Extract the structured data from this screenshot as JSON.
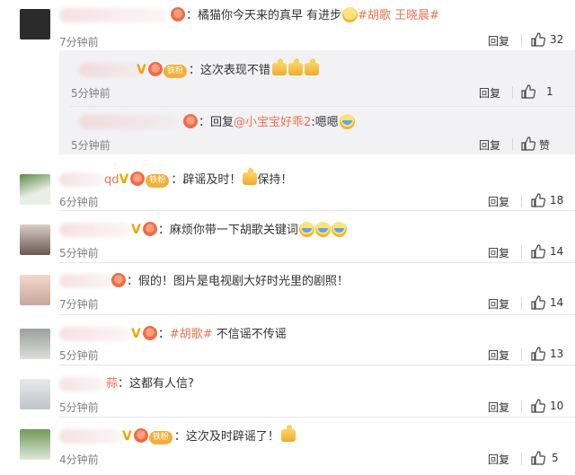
{
  "comments": [
    {
      "id": "c1",
      "time": "7分钟前",
      "reply": "回复",
      "likes": "32",
      "prefix": "：",
      "text": "橘猫你今天来的真早 有进步",
      "tag": "#胡歌 王晓晨#"
    },
    {
      "id": "c2",
      "time": "5分钟前",
      "reply": "回复",
      "likes": "1",
      "fan_badge": "铁粉",
      "prefix": "：",
      "text": "这次表现不错"
    },
    {
      "id": "c3",
      "time": "5分钟前",
      "reply": "回复",
      "likes": "赞",
      "prefix": "：",
      "reply_word": "回复",
      "mention": "@小宝宝好乖2",
      "colon": ":",
      "text": "嗯嗯"
    },
    {
      "id": "c4",
      "time": "6分钟前",
      "reply": "回复",
      "likes": "18",
      "fan_badge": "铁粉",
      "name_tail": "qd",
      "prefix": "：",
      "text": "辟谣及时！",
      "text2": "保持！"
    },
    {
      "id": "c5",
      "time": "5分钟前",
      "reply": "回复",
      "likes": "14",
      "prefix": "：",
      "text": "麻烦你带一下胡歌关键词"
    },
    {
      "id": "c6",
      "time": "7分钟前",
      "reply": "回复",
      "likes": "14",
      "prefix": "：",
      "text": "假的！图片是电视剧大好时光里的剧照！"
    },
    {
      "id": "c7",
      "time": "5分钟前",
      "reply": "回复",
      "likes": "13",
      "prefix": "：",
      "tag": "#胡歌#",
      "text": " 不信谣不传谣"
    },
    {
      "id": "c8",
      "time": "5分钟前",
      "reply": "回复",
      "likes": "10",
      "name_tail": "蒜",
      "prefix": "：",
      "text": "这都有人信?"
    },
    {
      "id": "c9",
      "time": "4分钟前",
      "reply": "回复",
      "likes": "5",
      "fan_badge": "铁粉",
      "prefix": "：",
      "text": "这次及时辟谣了！"
    }
  ],
  "colors": {
    "accent": "#eb7350",
    "vip": "#f0a500",
    "fan": "#f0b03a"
  }
}
